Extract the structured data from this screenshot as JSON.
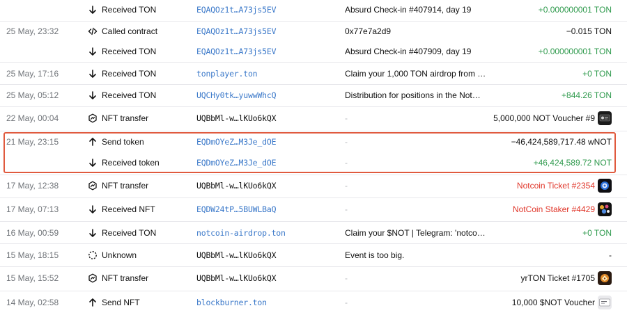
{
  "rows": [
    {
      "date": "",
      "icon": "arrow-down-icon",
      "action": "Received TON",
      "address": "EQAQOz1t…A73js5EV",
      "addr_link": true,
      "comment": "Absurd Check-in #407914, day 19",
      "comment_dim": false,
      "value": "+0.000000001 TON",
      "value_color": "pos",
      "thumb": ""
    },
    {
      "date": "25 May, 23:32",
      "icon": "code-icon",
      "action": "Called contract",
      "address": "EQAQOz1t…A73js5EV",
      "addr_link": true,
      "comment": "0x77e7a2d9",
      "comment_dim": false,
      "value": "−0.015 TON",
      "value_color": "neg",
      "thumb": ""
    },
    {
      "date": "",
      "icon": "arrow-down-icon",
      "action": "Received TON",
      "address": "EQAQOz1t…A73js5EV",
      "addr_link": true,
      "comment": "Absurd Check-in #407909, day 19",
      "comment_dim": false,
      "value": "+0.000000001 TON",
      "value_color": "pos",
      "thumb": ""
    },
    {
      "date": "25 May, 17:16",
      "icon": "arrow-down-icon",
      "action": "Received TON",
      "address": "tonplayer.ton",
      "addr_link": true,
      "comment": "Claim your 1,000 TON airdrop from …",
      "comment_dim": false,
      "value": "+0 TON",
      "value_color": "pos",
      "thumb": ""
    },
    {
      "date": "25 May, 05:12",
      "icon": "arrow-down-icon",
      "action": "Received TON",
      "address": "UQCHy0tk…yuwwWhcQ",
      "addr_link": true,
      "comment": "Distribution for positions in the Not…",
      "comment_dim": false,
      "value": "+844.26 TON",
      "value_color": "pos",
      "thumb": ""
    },
    {
      "date": "22 May, 00:04",
      "icon": "nft-icon",
      "action": "NFT transfer",
      "address": "UQBbMl-w…lKUo6kQX",
      "addr_link": false,
      "comment": "-",
      "comment_dim": true,
      "value": "5,000,000 NOT Voucher #9",
      "value_color": "black",
      "thumb": "voucher"
    },
    {
      "date": "21 May, 23:15",
      "icon": "arrow-up-icon",
      "action": "Send token",
      "address": "EQDmOYeZ…M3Je_dOE",
      "addr_link": true,
      "comment": "-",
      "comment_dim": true,
      "value": "−46,424,589,717.48 wNOT",
      "value_color": "neg",
      "thumb": ""
    },
    {
      "date": "",
      "icon": "arrow-down-icon",
      "action": "Received token",
      "address": "EQDmOYeZ…M3Je_dOE",
      "addr_link": true,
      "comment": "-",
      "comment_dim": true,
      "value": "+46,424,589.72 NOT",
      "value_color": "pos",
      "thumb": ""
    },
    {
      "date": "17 May, 12:38",
      "icon": "nft-icon",
      "action": "NFT transfer",
      "address": "UQBbMl-w…lKUo6kQX",
      "addr_link": false,
      "comment": "-",
      "comment_dim": true,
      "value": "Notcoin Ticket #2354",
      "value_color": "red",
      "thumb": "ticket"
    },
    {
      "date": "17 May, 07:13",
      "icon": "arrow-down-icon",
      "action": "Received NFT",
      "address": "EQDW24tP…5BUWLBaQ",
      "addr_link": true,
      "comment": "-",
      "comment_dim": true,
      "value": "NotCoin Staker #4429",
      "value_color": "red",
      "thumb": "staker"
    },
    {
      "date": "16 May, 00:59",
      "icon": "arrow-down-icon",
      "action": "Received TON",
      "address": "notcoin-airdrop.ton",
      "addr_link": true,
      "comment": "Claim your $NOT | Telegram: 'notco…",
      "comment_dim": false,
      "value": "+0 TON",
      "value_color": "pos",
      "thumb": ""
    },
    {
      "date": "15 May, 18:15",
      "icon": "unknown-icon",
      "action": "Unknown",
      "address": "UQBbMl-w…lKUo6kQX",
      "addr_link": false,
      "comment": "Event is too big.",
      "comment_dim": false,
      "value": "-",
      "value_color": "black",
      "thumb": ""
    },
    {
      "date": "15 May, 15:52",
      "icon": "nft-icon",
      "action": "NFT transfer",
      "address": "UQBbMl-w…lKUo6kQX",
      "addr_link": false,
      "comment": "-",
      "comment_dim": true,
      "value": "yrTON Ticket #1705",
      "value_color": "black",
      "thumb": "yrton"
    },
    {
      "date": "14 May, 02:58",
      "icon": "arrow-up-icon",
      "action": "Send NFT",
      "address": "blockburner.ton",
      "addr_link": true,
      "comment": "-",
      "comment_dim": true,
      "value": "10,000 $NOT Voucher",
      "value_color": "black",
      "thumb": "voucher2"
    }
  ]
}
